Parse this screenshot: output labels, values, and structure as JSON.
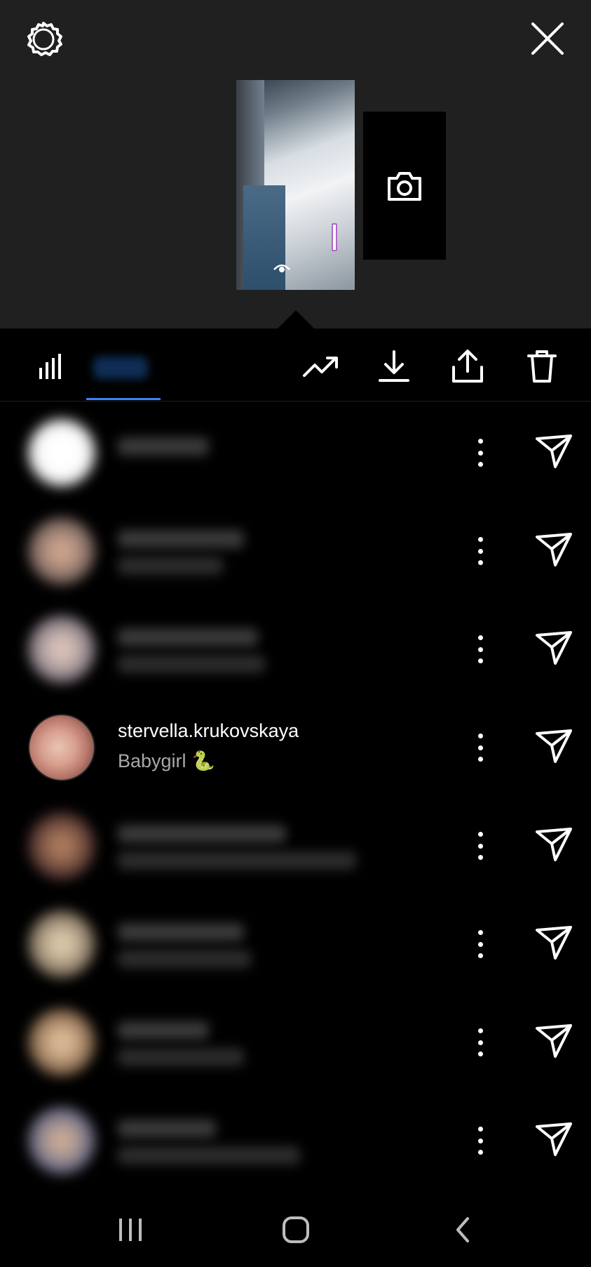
{
  "header": {
    "settings_icon": "settings-ring-icon",
    "close_icon": "close-x-icon"
  },
  "preview": {
    "thumbnail_alt": "story preview",
    "camera_icon": "camera-icon"
  },
  "toolbar": {
    "stats_icon": "bar-chart-icon",
    "insights_icon": "trending-up-icon",
    "download_icon": "download-icon",
    "share_icon": "share-icon",
    "delete_icon": "trash-icon",
    "active_tab_color": "#3b82f6"
  },
  "viewers": [
    {
      "visible": false
    },
    {
      "visible": false
    },
    {
      "visible": false
    },
    {
      "visible": true,
      "username": "stervella.krukovskaya",
      "bio": "Babygirl 🐍"
    },
    {
      "visible": false
    },
    {
      "visible": false
    },
    {
      "visible": false
    },
    {
      "visible": false
    }
  ],
  "navbar": {
    "recents_icon": "recents-icon",
    "home_icon": "home-icon",
    "back_icon": "back-icon"
  }
}
